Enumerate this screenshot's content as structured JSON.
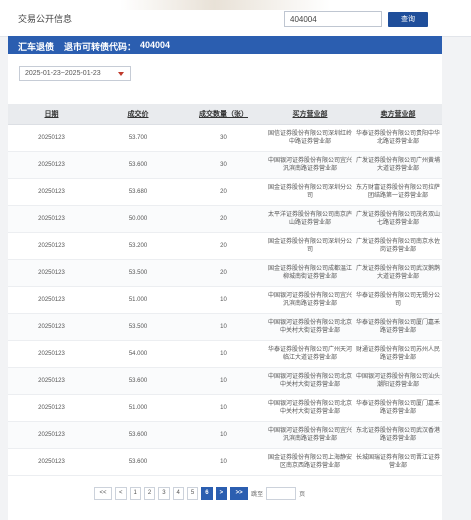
{
  "header": {
    "title": "交易公开信息",
    "search_value": "404004",
    "search_button": "查询"
  },
  "info": {
    "name": "汇车退债",
    "code_label": "退市可转债代码：",
    "code_value": "404004"
  },
  "filter": {
    "date_range": "2025-01-23~2025-01-23"
  },
  "table": {
    "headers": [
      "日期",
      "成交价",
      "成交数量（张）",
      "买方营业部",
      "卖方营业部"
    ],
    "rows": [
      [
        "20250123",
        "53.700",
        "30",
        "国信证券股份有限公司深圳红岭中路证券营业部",
        "华泰证券股份有限公司贵阳中华北路证券营业部"
      ],
      [
        "20250123",
        "53.600",
        "30",
        "中国银河证券股份有限公司宜兴汎滨南路证券营业部",
        "广发证券股份有限公司广州黄埔大道证券营业部"
      ],
      [
        "20250123",
        "53.680",
        "20",
        "国金证券股份有限公司深圳分公司",
        "东方财富证券股份有限公司拉萨团结路第一证券营业部"
      ],
      [
        "20250123",
        "50.000",
        "20",
        "太平洋证券股份有限公司南京庐山路证券营业部",
        "广发证券股份有限公司茂名双山七路证券营业部"
      ],
      [
        "20250123",
        "53.200",
        "20",
        "国金证券股份有限公司深圳分公司",
        "广发证券股份有限公司南京水佐岗证券营业部"
      ],
      [
        "20250123",
        "53.500",
        "20",
        "国金证券股份有限公司成都温江柳城南街证券营业部",
        "广发证券股份有限公司武汉鹅鹊大道证券营业部"
      ],
      [
        "20250123",
        "51.000",
        "10",
        "中国银河证券股份有限公司宜兴汎滨南路证券营业部",
        "华泰证券股份有限公司无锡分公司"
      ],
      [
        "20250123",
        "53.500",
        "10",
        "中国银河证券股份有限公司北京中关村大街证券营业部",
        "华泰证券股份有限公司厦门嘉禾路证券营业部"
      ],
      [
        "20250123",
        "54.000",
        "10",
        "华泰证券股份有限公司广州天河临江大道证券营业部",
        "财通证券股份有限公司苏州人民路证券营业部"
      ],
      [
        "20250123",
        "53.600",
        "10",
        "中国银河证券股份有限公司北京中关村大街证券营业部",
        "中国银河证券股份有限公司汕头潮阳证券营业部"
      ],
      [
        "20250123",
        "51.000",
        "10",
        "中国银河证券股份有限公司北京中关村大街证券营业部",
        "华泰证券股份有限公司厦门嘉禾路证券营业部"
      ],
      [
        "20250123",
        "53.600",
        "10",
        "中国银河证券股份有限公司宜兴汎滨南路证券营业部",
        "东北证券股份有限公司武汉香港路证券营业部"
      ],
      [
        "20250123",
        "53.600",
        "10",
        "国金证券股份有限公司上海静安区南京西路证券营业部",
        "长城国瑞证券有限公司晋江证券营业部"
      ]
    ]
  },
  "pagination": {
    "first": "<<",
    "prev": "<",
    "pages": [
      "1",
      "2",
      "3",
      "4",
      "5",
      "6"
    ],
    "current": "6",
    "next": ">",
    "last": ">>",
    "goto_prefix": "跳至",
    "goto_suffix": "页"
  }
}
